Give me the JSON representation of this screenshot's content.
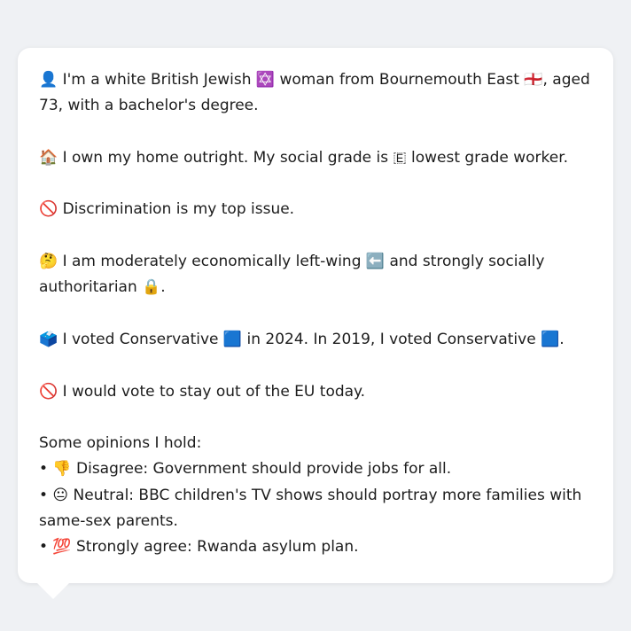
{
  "profile": {
    "p1": "👤 I'm a white British Jewish ✡️ woman from Bournemouth East 🏴󠁧󠁢󠁥󠁮󠁧󠁿, aged 73, with a bachelor's degree.",
    "p2": "🏠 I own my home outright. My social grade is 🇪 lowest grade worker.",
    "p3": "🚫 Discrimination is my top issue.",
    "p4": "🤔 I am moderately economically left-wing ⬅️ and strongly socially authoritarian 🔒.",
    "p5": "🗳️ I voted Conservative 🟦 in 2024. In 2019, I voted Conservative 🟦.",
    "p6": "🚫 I would vote to stay out of the EU today."
  },
  "opinions": {
    "heading": "Some opinions I hold:",
    "items": [
      "• 👎 Disagree: Government should provide jobs for all.",
      "• 😐 Neutral: BBC children's TV shows should portray more families with same-sex parents.",
      "• 💯 Strongly agree: Rwanda asylum plan."
    ]
  }
}
